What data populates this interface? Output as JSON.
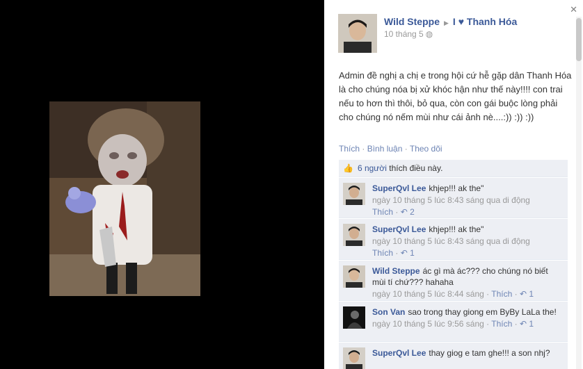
{
  "post": {
    "author": "Wild Steppe",
    "target_group": "I ♥ Thanh Hóa",
    "date": "10 tháng 5",
    "text": "Admin đề nghị a chị e trong hội cứ hễ gặp dân Thanh Hóa là cho chúng nóa bị xử khóc hận như thế này!!!! con trai nếu to hơn thì thôi, bỏ qua, còn con gái buộc lòng phải cho chúng nó nếm mùi như cái ảnh nè....:)) :)) :))",
    "actions": {
      "like": "Thích",
      "comment": "Bình luận",
      "follow": "Theo dõi"
    },
    "likes": {
      "count_text": "6 người",
      "suffix": "thích điều này."
    }
  },
  "comments": [
    {
      "name": "SuperQvl Lee",
      "text": "khjep!!! ak the\"",
      "time": "ngày 10 tháng 5 lúc 8:43 sáng qua di động",
      "like": "Thích",
      "likes": "2"
    },
    {
      "name": "SuperQvl Lee",
      "text": "khjep!!! ak the\"",
      "time": "ngày 10 tháng 5 lúc 8:43 sáng qua di động",
      "like": "Thích",
      "likes": "1"
    },
    {
      "name": "Wild Steppe",
      "text": "ác gì mà ác??? cho chúng nó biết mùi tí chứ??? hahaha",
      "time": "ngày 10 tháng 5 lúc 8:44 sáng",
      "like": "Thích",
      "likes": "1"
    },
    {
      "name": "Son Van",
      "text": "sao trong thay giong em ByBy LaLa the!",
      "time": "ngày 10 tháng 5 lúc 9:56 sáng",
      "like": "Thích",
      "likes": "1"
    },
    {
      "name": "SuperQvl Lee",
      "text": "thay giog e tam ghe!!! a son nhj?",
      "time": "",
      "like": "",
      "likes": ""
    }
  ],
  "icons": {
    "close": "close-icon",
    "globe": "globe-icon",
    "thumb": "thumbs-up-icon",
    "like_count": "like-count-icon",
    "arrow": "arrow-right-icon"
  },
  "colors": {
    "link": "#3b5998",
    "muted_link": "#6d84b4",
    "comment_bg": "#edeff4",
    "stage_bg": "#000000"
  }
}
